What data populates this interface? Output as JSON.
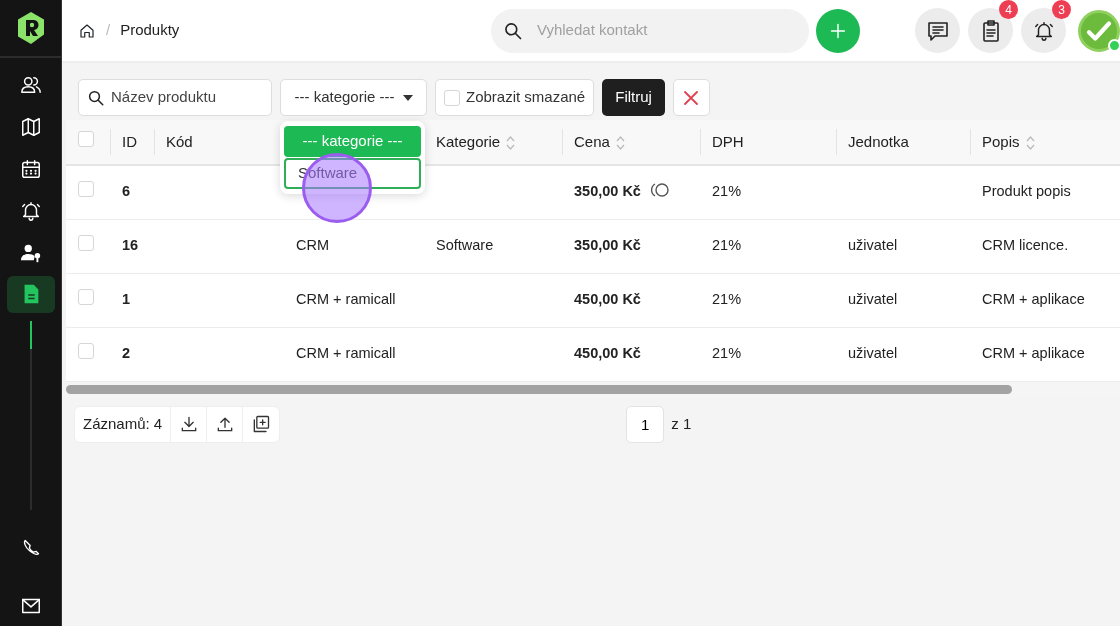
{
  "sidebar": {
    "items": [
      {
        "selected": false
      },
      {
        "selected": false
      },
      {
        "selected": false
      },
      {
        "selected": false
      },
      {
        "selected": false
      },
      {
        "selected": true
      }
    ]
  },
  "breadcrumb": {
    "separator": "/",
    "current": "Produkty"
  },
  "search": {
    "placeholder": "Vyhledat kontakt"
  },
  "header_buttons": [
    {
      "kind": "messages"
    },
    {
      "kind": "tasks",
      "badge": "4"
    },
    {
      "kind": "alerts",
      "badge": "3"
    }
  ],
  "user": {
    "online": true
  },
  "filters": {
    "name_placeholder": "Název produktu",
    "category_value": "--- kategorie ---",
    "show_deleted": {
      "label": "Zobrazit smazané",
      "checked": false
    },
    "filter_button": "Filtruj"
  },
  "category_dropdown": {
    "open": true,
    "options": [
      {
        "label": "--- kategorie ---",
        "selected": true,
        "highlighted": false,
        "clicked": false
      },
      {
        "label": "Software",
        "selected": false,
        "highlighted": true,
        "clicked": true
      }
    ]
  },
  "table": {
    "select_all": {
      "checked": false
    },
    "columns": [
      {
        "label": "ID",
        "sortable": false
      },
      {
        "label": "Kód",
        "sortable": false
      },
      {
        "label": "Kategorie",
        "sortable": true
      },
      {
        "label": "Cena",
        "sortable": true
      },
      {
        "label": "DPH",
        "sortable": false
      },
      {
        "label": "Jednotka",
        "sortable": false
      },
      {
        "label": "Popis",
        "sortable": true
      }
    ],
    "rows": [
      {
        "checked": false,
        "id": "6",
        "price": "350,00 Kč",
        "loading": true,
        "vat": "21%",
        "description": "Produkt popis"
      },
      {
        "checked": false,
        "id": "16",
        "name": "CRM",
        "category": "Software",
        "price": "350,00 Kč",
        "loading": false,
        "vat": "21%",
        "unit": "uživatel",
        "description": "CRM licence."
      },
      {
        "checked": false,
        "id": "1",
        "name": "CRM + ramicall",
        "price": "450,00 Kč",
        "loading": false,
        "vat": "21%",
        "unit": "uživatel",
        "description": "CRM + aplikace"
      },
      {
        "checked": false,
        "id": "2",
        "name": "CRM + ramicall",
        "price": "450,00 Kč",
        "loading": false,
        "vat": "21%",
        "unit": "uživatel",
        "description": "CRM + aplikace"
      }
    ]
  },
  "footer": {
    "records": "Záznamů: 4",
    "page": "1",
    "page_total": "z 1"
  }
}
